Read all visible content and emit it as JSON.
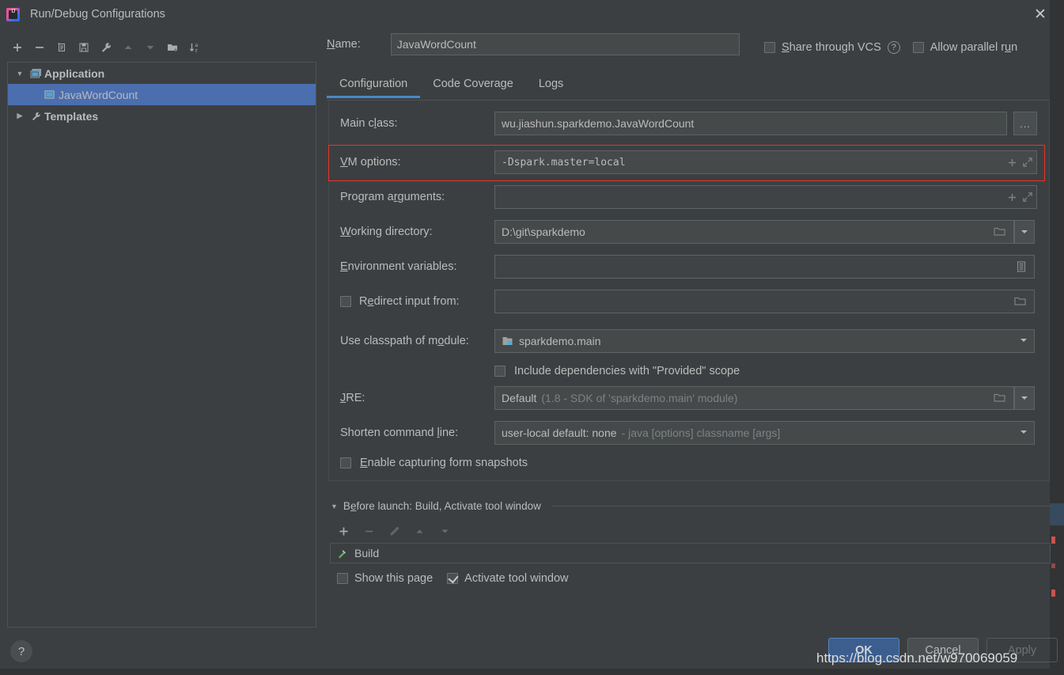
{
  "window": {
    "title": "Run/Debug Configurations",
    "app_icon": "intellij-idea-icon",
    "close_label": "✕",
    "accent_blue": "#4a88c7",
    "selection_blue": "#4b6eaf",
    "highlight_red": "#e8342b",
    "background": "#3c3f41"
  },
  "left_toolbar": {
    "buttons": [
      {
        "name": "add-configuration-button",
        "icon": "plus-icon",
        "enabled": true
      },
      {
        "name": "remove-configuration-button",
        "icon": "minus-icon",
        "enabled": true
      },
      {
        "name": "copy-configuration-button",
        "icon": "copy-icon",
        "enabled": true
      },
      {
        "name": "save-configuration-button",
        "icon": "save-icon",
        "enabled": true
      },
      {
        "name": "edit-templates-button",
        "icon": "wrench-icon",
        "enabled": true
      },
      {
        "name": "move-up-button",
        "icon": "arrow-up-icon",
        "enabled": false
      },
      {
        "name": "move-down-button",
        "icon": "arrow-down-icon",
        "enabled": false
      },
      {
        "name": "new-folder-button",
        "icon": "folder-add-icon",
        "enabled": true
      },
      {
        "name": "sort-alphabetically-button",
        "icon": "sort-az-icon",
        "enabled": true
      }
    ]
  },
  "tree": {
    "items": [
      {
        "label": "Application",
        "icon": "application-icon",
        "twisty": "▼",
        "bold": true,
        "selected": false,
        "indent": 0
      },
      {
        "label": "JavaWordCount",
        "icon": "run-config-icon",
        "twisty": "",
        "bold": false,
        "selected": true,
        "indent": 1
      },
      {
        "label": "Templates",
        "icon": "wrench-icon",
        "twisty": "▶",
        "bold": true,
        "selected": false,
        "indent": 0
      }
    ]
  },
  "header": {
    "name_label": "Name:",
    "name_label_mnemonic": "N",
    "name_value": "JavaWordCount",
    "name_placeholder": "Name",
    "share_vcs_label": "Share through VCS",
    "share_vcs_mnemonic": "S",
    "share_vcs_checked": false,
    "share_vcs_help": "?",
    "allow_parallel_label": "Allow parallel run",
    "allow_parallel_mnemonic": "u",
    "allow_parallel_checked": false
  },
  "tabs": [
    {
      "label": "Configuration",
      "active": true
    },
    {
      "label": "Code Coverage",
      "active": false
    },
    {
      "label": "Logs",
      "active": false
    }
  ],
  "fields": {
    "main_class": {
      "label_pre": "Main c",
      "label_mn": "l",
      "label_post": "ass:",
      "value": "wu.jiashun.sparkdemo.JavaWordCount",
      "browse_label": "..."
    },
    "vm_options": {
      "label_pre": "",
      "label_mn": "V",
      "label_post": "M options:",
      "value": "-Dspark.master=local",
      "macro_icon": "plus-icon",
      "expand_icon": "expand-diagonal-icon",
      "highlighted": true
    },
    "program_arguments": {
      "label_pre": "Program a",
      "label_mn": "r",
      "label_post": "guments:",
      "value": "",
      "macro_icon": "plus-icon",
      "expand_icon": "expand-diagonal-icon"
    },
    "working_directory": {
      "label_pre": "",
      "label_mn": "W",
      "label_post": "orking directory:",
      "value": "D:\\git\\sparkdemo",
      "folder_icon": "folder-icon",
      "dropdown_icon": "chevron-down-icon"
    },
    "environment_variables": {
      "label_pre": "",
      "label_mn": "E",
      "label_post": "nvironment variables:",
      "value": "",
      "list_icon": "env-list-icon"
    },
    "redirect_input": {
      "label_pre": "R",
      "label_mn": "e",
      "label_post": "direct input from:",
      "checked": false,
      "value": "",
      "folder_icon": "folder-icon"
    },
    "classpath_module": {
      "label_pre": "Use classpath of m",
      "label_mn": "o",
      "label_post": "dule:",
      "value": "sparkdemo.main",
      "module_icon": "module-icon",
      "dropdown_icon": "chevron-down-icon"
    },
    "include_provided": {
      "label": "Include dependencies with \"Provided\" scope",
      "checked": false
    },
    "jre": {
      "label_pre": "",
      "label_mn": "J",
      "label_post": "RE:",
      "value": "Default",
      "value_detail": "(1.8 - SDK of 'sparkdemo.main' module)",
      "folder_icon": "folder-icon",
      "dropdown_icon": "chevron-down-icon"
    },
    "shorten_command_line": {
      "label_pre": "Shorten command ",
      "label_mn": "l",
      "label_post": "ine:",
      "value": "user-local default: none",
      "value_detail": "- java [options] classname [args]",
      "dropdown_icon": "chevron-down-icon"
    },
    "form_snapshots": {
      "label_pre": "",
      "label_mn": "E",
      "label_post": "nable capturing form snapshots",
      "checked": false
    }
  },
  "before_launch": {
    "twisty": "▼",
    "title_pre": "B",
    "title_mn": "e",
    "title_post": "fore launch: Build, Activate tool window",
    "toolbar": [
      {
        "name": "add-task-button",
        "icon": "plus-icon",
        "enabled": true
      },
      {
        "name": "remove-task-button",
        "icon": "minus-icon",
        "enabled": false
      },
      {
        "name": "edit-task-button",
        "icon": "pencil-icon",
        "enabled": false
      },
      {
        "name": "task-move-up-button",
        "icon": "arrow-up-icon",
        "enabled": false
      },
      {
        "name": "task-move-down-button",
        "icon": "arrow-down-icon",
        "enabled": false
      }
    ],
    "tasks": [
      {
        "label": "Build",
        "icon": "build-hammer-icon"
      }
    ],
    "show_page_label": "Show this page",
    "show_page_checked": false,
    "activate_tool_window_label": "Activate tool window",
    "activate_tool_window_checked": true
  },
  "footer": {
    "help_label": "?",
    "ok_label": "OK",
    "cancel_label": "Cancel",
    "apply_label": "Apply",
    "apply_enabled": false,
    "watermark": "https://blog.csdn.net/w970069059"
  }
}
